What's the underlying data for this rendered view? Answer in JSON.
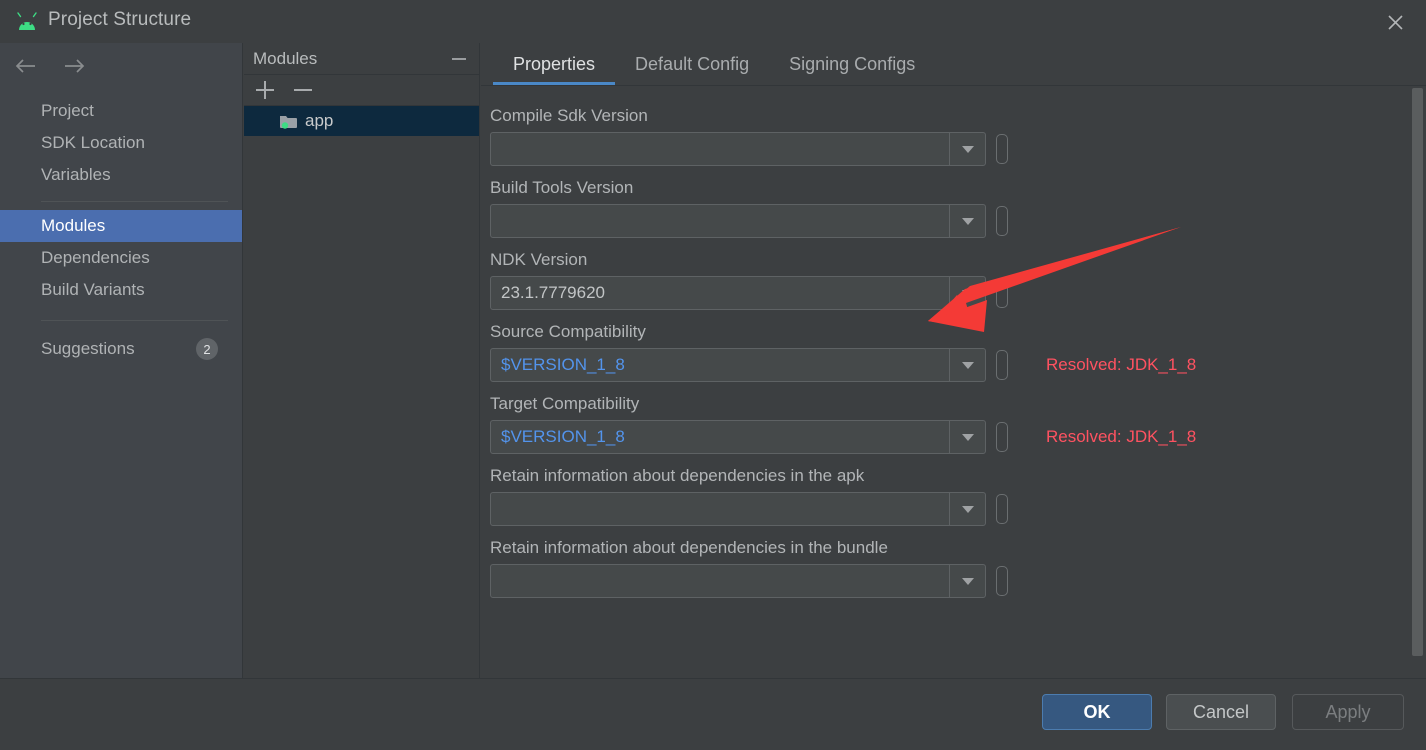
{
  "window": {
    "title": "Project Structure",
    "logo_icon": "android-logo-icon",
    "close_icon": "close-icon"
  },
  "sidebar": {
    "back_icon": "arrow-left-icon",
    "forward_icon": "arrow-right-icon",
    "items": [
      {
        "label": "Project",
        "selected": false
      },
      {
        "label": "SDK Location",
        "selected": false
      },
      {
        "label": "Variables",
        "selected": false
      },
      {
        "label": "Modules",
        "selected": true
      },
      {
        "label": "Dependencies",
        "selected": false
      },
      {
        "label": "Build Variants",
        "selected": false
      }
    ],
    "suggestions": {
      "label": "Suggestions",
      "count": "2"
    }
  },
  "modules_panel": {
    "title": "Modules",
    "collapse_icon": "collapse-icon",
    "add_icon": "plus-icon",
    "remove_icon": "minus-icon",
    "items": [
      {
        "name": "app",
        "icon": "module-folder-icon",
        "selected": true,
        "has_error": true
      }
    ]
  },
  "tabs": [
    {
      "label": "Properties",
      "active": true
    },
    {
      "label": "Default Config",
      "active": false
    },
    {
      "label": "Signing Configs",
      "active": false
    }
  ],
  "properties": {
    "fields": [
      {
        "label": "Compile Sdk Version",
        "value": "",
        "is_variable": false,
        "resolved": ""
      },
      {
        "label": "Build Tools Version",
        "value": "",
        "is_variable": false,
        "resolved": ""
      },
      {
        "label": "NDK Version",
        "value": "23.1.7779620",
        "is_variable": false,
        "resolved": ""
      },
      {
        "label": "Source Compatibility",
        "value": "$VERSION_1_8",
        "is_variable": true,
        "resolved": "Resolved: JDK_1_8"
      },
      {
        "label": "Target Compatibility",
        "value": "$VERSION_1_8",
        "is_variable": true,
        "resolved": "Resolved: JDK_1_8"
      },
      {
        "label": "Retain information about dependencies in the apk",
        "value": "",
        "is_variable": false,
        "resolved": ""
      },
      {
        "label": "Retain information about dependencies in the bundle",
        "value": "",
        "is_variable": false,
        "resolved": ""
      }
    ]
  },
  "buttons": {
    "ok": "OK",
    "cancel": "Cancel",
    "apply": "Apply"
  },
  "colors": {
    "accent_blue": "#4b6eaf",
    "tab_underline": "#4a88c7",
    "variable_text": "#5394ec",
    "resolved_text": "#ff5261",
    "annotation_arrow": "#f43a36",
    "module_selected_bg": "#0d293e",
    "error_squiggle": "#e8a33d",
    "ok_button_bg": "#365880",
    "android_green": "#3ddc84"
  }
}
